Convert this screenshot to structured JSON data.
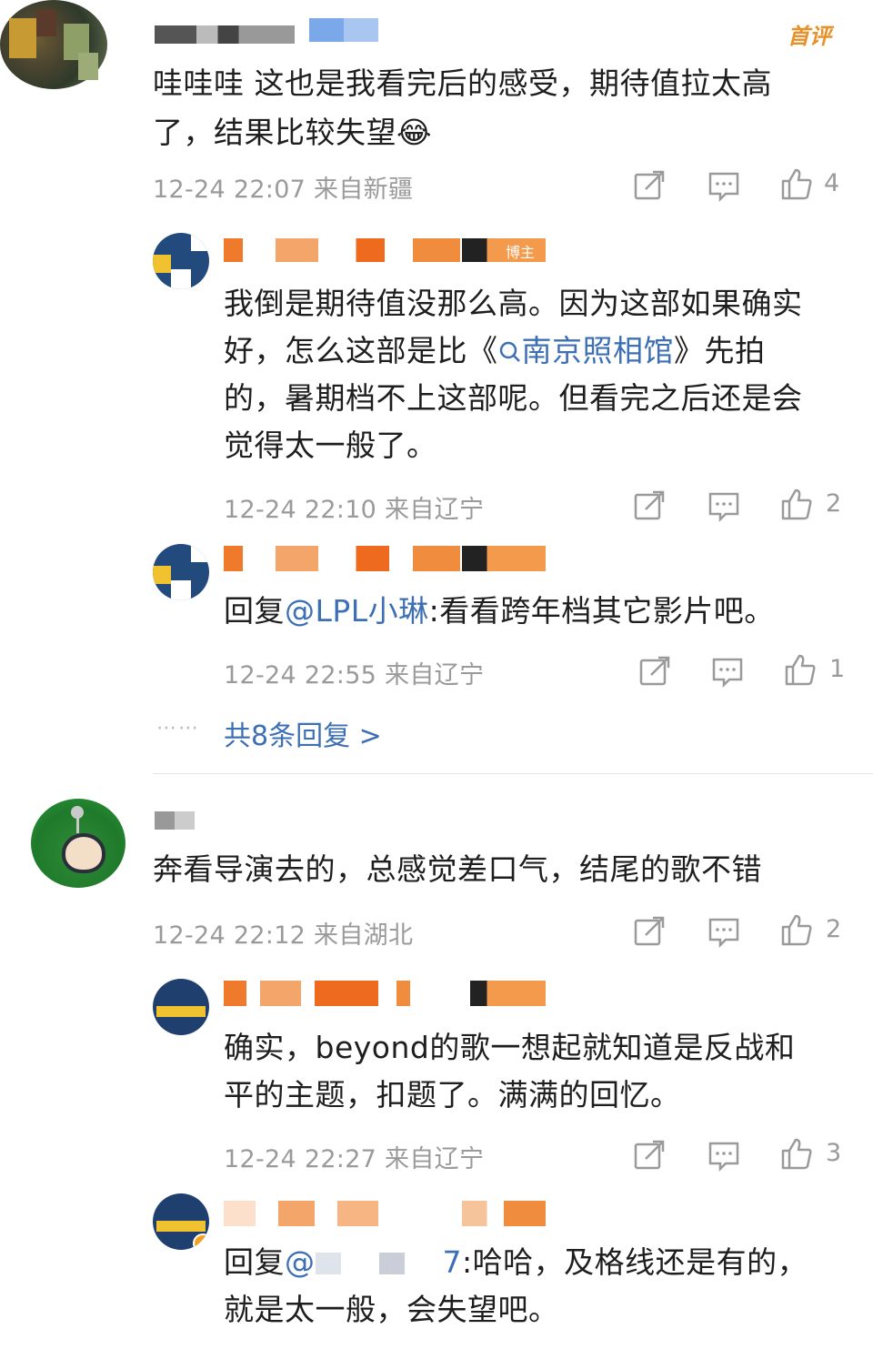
{
  "comments": [
    {
      "badge": "首评",
      "text_line1": "哇哇哇 这也是我看完后的感受，期待值拉太高",
      "text_line2": "了，结果比较失望😂",
      "time": "12-24 22:07",
      "location": "来自新疆",
      "likes": "4"
    },
    {
      "text_line1": "奔看导演去的，总感觉差口气，结尾的歌不错",
      "time": "12-24 22:12",
      "location": "来自湖北",
      "likes": "2"
    }
  ],
  "replies": [
    {
      "author_badge": "博主",
      "lines": [
        "我倒是期待值没那么高。因为这部如果确实",
        "好，怎么这部是比《",
        "南京照相馆",
        "》先拍",
        "的，暑期档不上这部呢。但看完之后还是会",
        "觉得太一般了。"
      ],
      "time": "12-24 22:10",
      "location": "来自辽宁",
      "likes": "2"
    },
    {
      "prefix": "回复",
      "mention": "@LPL小琳",
      "text": ":看看跨年档其它影片吧。",
      "time": "12-24 22:55",
      "location": "来自辽宁",
      "likes": "1"
    },
    {
      "lines": [
        "确实，beyond的歌一想起就知道是反战和",
        "平的主题，扣题了。满满的回忆。"
      ],
      "time": "12-24 22:27",
      "location": "来自辽宁",
      "likes": "3"
    },
    {
      "prefix": "回复",
      "mention": "@",
      "mention_tail": "7",
      "text": ":哈哈，及格线还是有的，",
      "line2": "就是太一般，会失望吧。"
    }
  ],
  "more_replies": "共8条回复 >",
  "more_dots": "⋯⋯",
  "icons": [
    "share-icon",
    "comment-icon",
    "like-icon"
  ]
}
